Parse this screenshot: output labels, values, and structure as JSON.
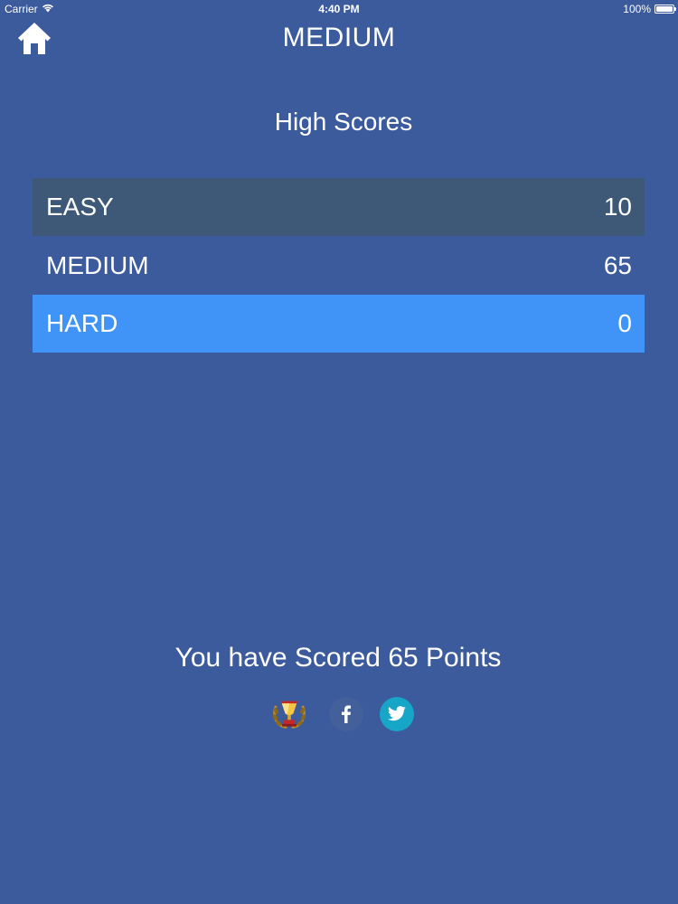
{
  "status_bar": {
    "carrier": "Carrier",
    "time": "4:40 PM",
    "battery": "100%"
  },
  "nav": {
    "title": "MEDIUM",
    "home_icon": "home-icon"
  },
  "high_scores": {
    "title": "High Scores",
    "rows": [
      {
        "label": "EASY",
        "score": "10"
      },
      {
        "label": "MEDIUM",
        "score": "65"
      },
      {
        "label": "HARD",
        "score": "0"
      }
    ]
  },
  "result": {
    "text": "You have Scored 65 Points"
  },
  "share": {
    "icons": [
      "trophy-icon",
      "facebook-icon",
      "twitter-icon"
    ]
  },
  "colors": {
    "background": "#3b5b9c",
    "row_dim": "#3e5878",
    "row_selected": "#4194f7",
    "facebook": "#44609a",
    "twitter": "#17a6c8"
  }
}
